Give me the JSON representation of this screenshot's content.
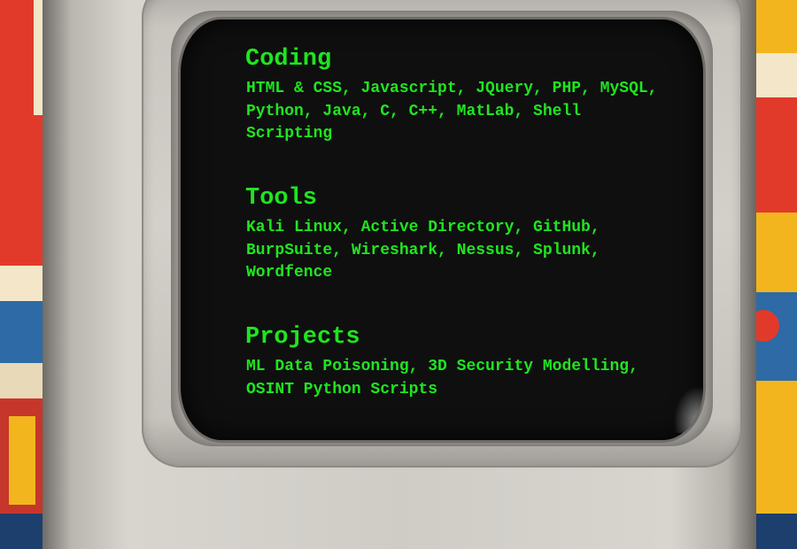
{
  "terminal": {
    "sections": [
      {
        "title": "Coding",
        "body": "HTML & CSS, Javascript, JQuery, PHP, MySQL, Python, Java, C, C++, MatLab, Shell Scripting"
      },
      {
        "title": "Tools",
        "body": "Kali Linux, Active Directory, GitHub, BurpSuite, Wireshark, Nessus, Splunk, Wordfence"
      },
      {
        "title": "Projects",
        "body": "ML Data Poisoning, 3D Security Modelling, OSINT Python Scripts"
      }
    ]
  },
  "colors": {
    "terminal_text": "#1fe51f",
    "screen": "#0f0f10",
    "monitor_frame": "#cfccc6"
  }
}
